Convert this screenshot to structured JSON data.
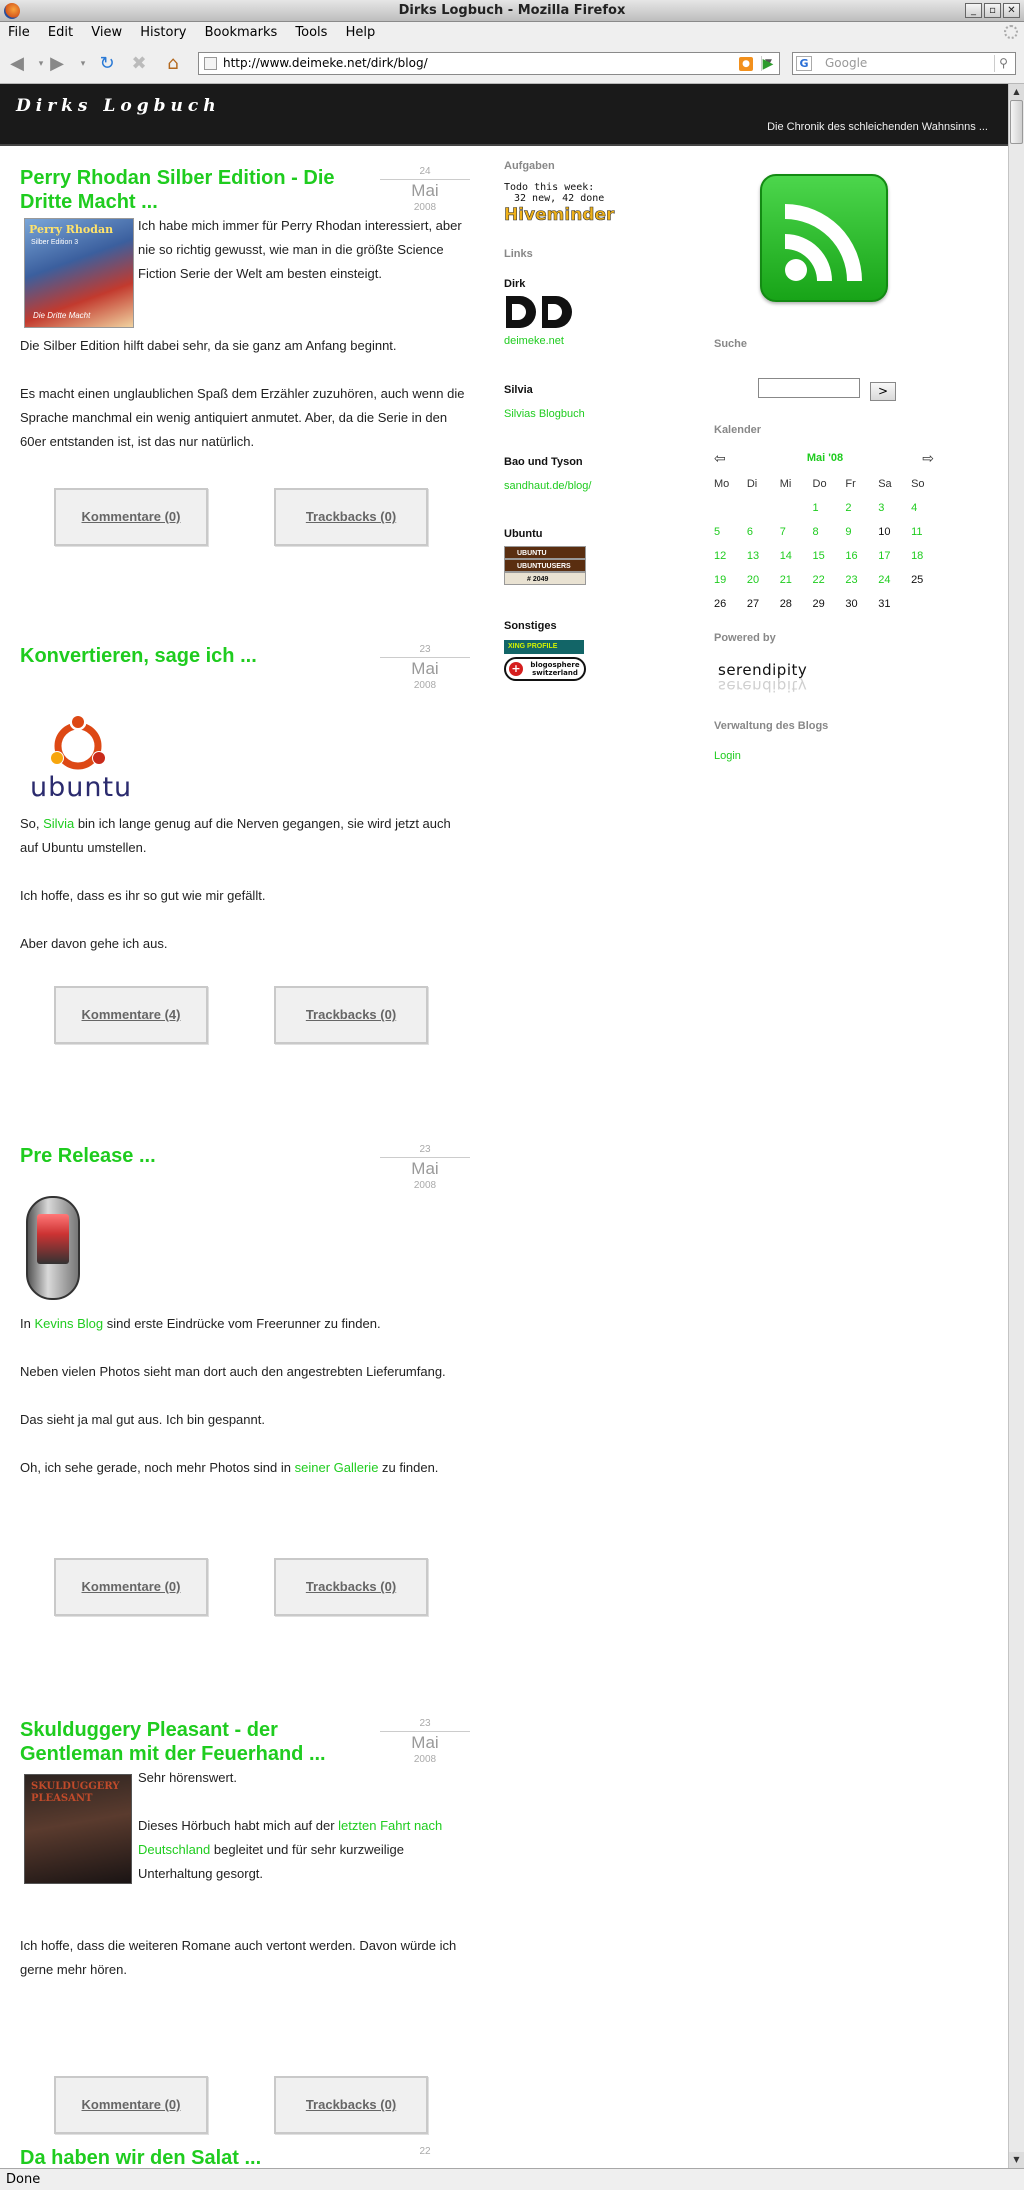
{
  "window": {
    "title": "Dirks Logbuch - Mozilla Firefox",
    "buttons": [
      "_",
      "▫",
      "✕"
    ]
  },
  "menu": [
    "File",
    "Edit",
    "View",
    "History",
    "Bookmarks",
    "Tools",
    "Help"
  ],
  "nav": {
    "url": "http://www.deimeke.net/dirk/blog/",
    "search_placeholder": "Google"
  },
  "status": "Done",
  "blog": {
    "title": "Dirks Logbuch",
    "subtitle": "Die Chronik des schleichenden Wahnsinns ..."
  },
  "entries": [
    {
      "title": "Perry Rhodan Silber Edition - Die Dritte Macht ...",
      "day": "24",
      "month": "Mai",
      "year": "2008",
      "paragraphs": [
        "Ich habe mich immer für Perry Rhodan interessiert, aber nie so richtig gewusst, wie man in die größte Science Fiction Serie der Welt am besten einsteigt.",
        "Die Silber Edition hilft dabei sehr, da sie ganz am Anfang beginnt.",
        "Es macht einen unglaublichen Spaß dem Erzähler zuzuhören, auch wenn die Sprache manchmal ein wenig antiquiert anmutet. Aber, da die Serie in den 60er entstanden ist, ist das nur natürlich."
      ],
      "cover_lines": [
        "Perry Rhodan",
        "Silber Edition 3",
        "Die Dritte Macht"
      ],
      "comments": "Kommentare (0)",
      "trackbacks": "Trackbacks (0)"
    },
    {
      "title": "Konvertieren, sage ich ...",
      "day": "23",
      "month": "Mai",
      "year": "2008",
      "logo_text": "ubuntu",
      "p1_pre": "So, ",
      "p1_link": "Silvia",
      "p1_post": " bin ich lange genug auf die Nerven gegangen, sie wird jetzt auch auf Ubuntu umstellen.",
      "p2": "Ich hoffe, dass es ihr so gut wie mir gefällt.",
      "p3": "Aber davon gehe ich aus.",
      "comments": "Kommentare (4)",
      "trackbacks": "Trackbacks (0)"
    },
    {
      "title": "Pre Release ...",
      "day": "23",
      "month": "Mai",
      "year": "2008",
      "p1_pre": "In ",
      "p1_link": "Kevins Blog",
      "p1_post": " sind erste Eindrücke vom Freerunner zu finden.",
      "p2": "Neben vielen Photos sieht man dort auch den angestrebten Lieferumfang.",
      "p3": "Das sieht ja mal gut aus. Ich bin gespannt.",
      "p4_pre": "Oh, ich sehe gerade, noch mehr Photos sind in ",
      "p4_link": "seiner Gallerie",
      "p4_post": " zu finden.",
      "comments": "Kommentare (0)",
      "trackbacks": "Trackbacks (0)"
    },
    {
      "title": "Skulduggery Pleasant - der Gentleman mit der Feuerhand ...",
      "day": "23",
      "month": "Mai",
      "year": "2008",
      "cover_text": "SKULDUGGERY PLEASANT",
      "p1": "Sehr hörenswert.",
      "p2_pre": "Dieses Hörbuch habt mich auf der ",
      "p2_link": "letzten Fahrt nach Deutschland",
      "p2_post": " begleitet und für sehr kurzweilige Unterhaltung gesorgt.",
      "p3": "Ich hoffe, dass die weiteren Romane auch vertont werden. Davon würde ich gerne mehr hören.",
      "comments": "Kommentare (0)",
      "trackbacks": "Trackbacks (0)"
    },
    {
      "title": "Da haben wir den Salat ...",
      "day": "22"
    }
  ],
  "middle_sidebar": {
    "aufgaben": "Aufgaben",
    "todo_line1": "Todo this week:",
    "todo_line2": "32 new, 42 done",
    "hiveminder": "Hiveminder",
    "links": "Links",
    "dirk": "Dirk",
    "dirk_link": "deimeke.net",
    "silvia": "Silvia",
    "silvia_link": "Silvias Blogbuch",
    "bao": "Bao und Tyson",
    "bao_link": "sandhaut.de/blog/",
    "ubuntu": "Ubuntu",
    "ubuntu_badges": [
      "UBUNTU",
      "UBUNTUUSERS",
      "# 2049"
    ],
    "sonstiges": "Sonstiges",
    "xing": "XING PROFILE",
    "swiss": "blogosphere switzerland"
  },
  "right_sidebar": {
    "suche": "Suche",
    "search_go": ">",
    "kalender": "Kalender",
    "month": "Mai '08",
    "weekdays": [
      "Mo",
      "Di",
      "Mi",
      "Do",
      "Fr",
      "Sa",
      "So"
    ],
    "weeks": [
      [
        "",
        "",
        "",
        "1",
        "2",
        "3",
        "4"
      ],
      [
        "5",
        "6",
        "7",
        "8",
        "9",
        "10",
        "11"
      ],
      [
        "12",
        "13",
        "14",
        "15",
        "16",
        "17",
        "18"
      ],
      [
        "19",
        "20",
        "21",
        "22",
        "23",
        "24",
        "25"
      ],
      [
        "26",
        "27",
        "28",
        "29",
        "30",
        "31",
        ""
      ]
    ],
    "plain_days": [
      "10",
      "25",
      "26",
      "27",
      "28",
      "29",
      "30",
      "31"
    ],
    "powered": "Powered by",
    "serendipity": "serendipity",
    "verwaltung": "Verwaltung des Blogs",
    "login": "Login"
  },
  "colors": {
    "accent_green": "#1fcc1f",
    "header_bg": "#1a1a1a",
    "rss_green": "#2fb52f"
  }
}
